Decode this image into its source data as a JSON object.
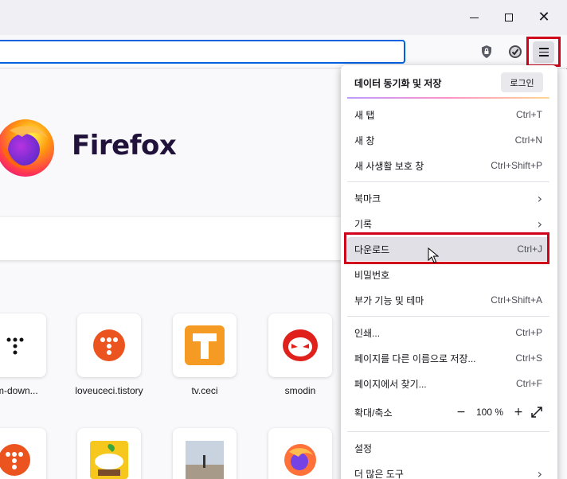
{
  "window": {
    "minimize_icon": "minimize-icon",
    "maximize_icon": "maximize-icon",
    "close_icon": "close-icon",
    "close_glyph": "✕"
  },
  "toolbar": {
    "shield_icon": "shield-icon",
    "check_icon": "check-icon",
    "menu_icon": "hamburger-menu-icon"
  },
  "newtab": {
    "brand": "Firefox",
    "top_sites": [
      {
        "label": "om-down..."
      },
      {
        "label": "loveuceci.tistory"
      },
      {
        "label": "tv.ceci"
      },
      {
        "label": "smodin"
      }
    ]
  },
  "menu": {
    "sync_title": "데이터 동기화 및 저장",
    "login": "로그인",
    "items": [
      {
        "label": "새 탭",
        "shortcut": "Ctrl+T"
      },
      {
        "label": "새 창",
        "shortcut": "Ctrl+N"
      },
      {
        "label": "새 사생활 보호 창",
        "shortcut": "Ctrl+Shift+P"
      },
      {
        "label": "북마크",
        "shortcut": ""
      },
      {
        "label": "기록",
        "shortcut": ""
      },
      {
        "label": "다운로드",
        "shortcut": "Ctrl+J"
      },
      {
        "label": "비밀번호",
        "shortcut": ""
      },
      {
        "label": "부가 기능 및 테마",
        "shortcut": "Ctrl+Shift+A"
      },
      {
        "label": "인쇄...",
        "shortcut": "Ctrl+P"
      },
      {
        "label": "페이지를 다른 이름으로 저장...",
        "shortcut": "Ctrl+S"
      },
      {
        "label": "페이지에서 찾기...",
        "shortcut": "Ctrl+F"
      },
      {
        "label": "확대/축소",
        "shortcut": ""
      },
      {
        "label": "설정",
        "shortcut": ""
      },
      {
        "label": "더 많은 도구",
        "shortcut": ""
      }
    ],
    "zoom": {
      "minus": "−",
      "value": "100 %",
      "plus": "+",
      "fullscreen_icon": "fullscreen-icon"
    },
    "chevron": "›"
  },
  "colors": {
    "highlight_border": "#d0021b",
    "accent": "#0061e0"
  }
}
